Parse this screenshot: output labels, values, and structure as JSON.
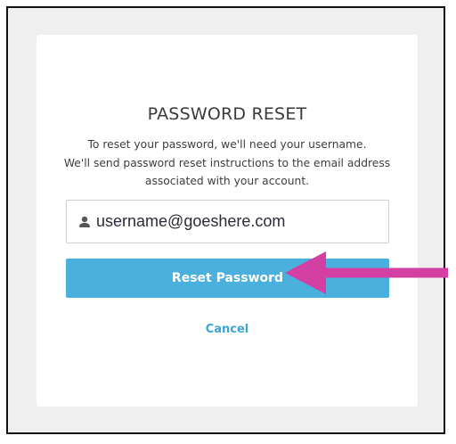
{
  "title": "PASSWORD RESET",
  "description": {
    "line1": "To reset your password, we'll need your username.",
    "line2": "We'll send password reset instructions to the email address",
    "line3": "associated with your account."
  },
  "username_field": {
    "icon": "user-icon",
    "value": "username@goeshere.com"
  },
  "reset_button_label": "Reset Password",
  "cancel_label": "Cancel",
  "colors": {
    "button": "#4ab0de",
    "link": "#3aa6d6",
    "annotation_arrow": "#d43fa3"
  }
}
